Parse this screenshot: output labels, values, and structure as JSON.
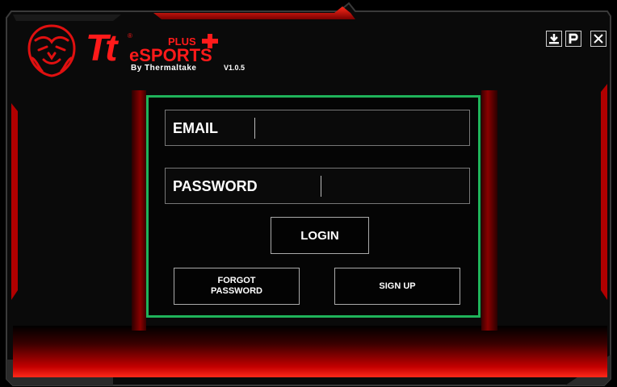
{
  "app": {
    "brand_short": "Tt",
    "brand_plus": "PLUS",
    "brand_esports": "eSPORTS",
    "brand_by": "By Thermaltake",
    "version": "V1.0.5",
    "registered": "®"
  },
  "window_controls": {
    "download": "download-icon",
    "help": "help-icon",
    "close": "close-icon"
  },
  "form": {
    "email_label": "EMAIL",
    "email_value": "",
    "password_label": "PASSWORD",
    "password_value": "",
    "login_label": "LOGIN",
    "forgot_label_line1": "FORGOT",
    "forgot_label_line2": "PASSWORD",
    "signup_label": "SIGN UP"
  },
  "colors": {
    "accent_red": "#ff1a1a",
    "panel_border": "#1fb35a"
  }
}
